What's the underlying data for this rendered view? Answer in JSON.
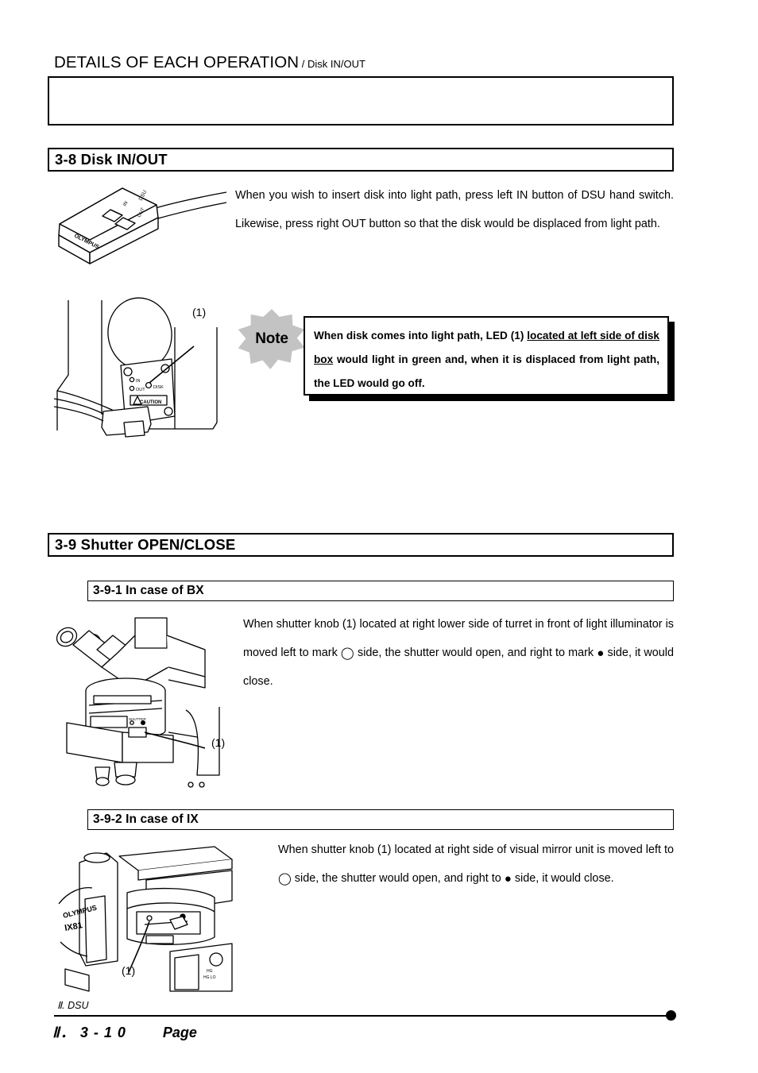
{
  "header": {
    "main_title": "DETAILS OF EACH OPERATION",
    "sub_title": " / Disk IN/OUT"
  },
  "sections": {
    "disk_inout": {
      "heading": "3-8 Disk IN/OUT",
      "paragraph": "When you wish to insert disk into light path, press left IN button of DSU hand switch. Likewise, press right OUT button so that the disk would be displaced from light path."
    },
    "shutter": {
      "heading": "3-9 Shutter OPEN/CLOSE",
      "bx": {
        "heading": "3-9-1 In case of BX",
        "paragraph_part1": "When shutter knob (1) located at right lower side of turret in front of light illuminator is moved left to mark ",
        "open_symbol": "◯",
        "paragraph_part2": " side, the shutter would open, and right to mark ",
        "close_symbol": "●",
        "paragraph_part3": " side, it would close."
      },
      "ix": {
        "heading": "3-9-2 In case of IX",
        "paragraph_part1": "When shutter knob (1) located at right side of visual mirror unit is moved left to ",
        "open_symbol": "◯",
        "paragraph_part2": " side, the shutter would open, and right to ",
        "close_symbol": "●",
        "paragraph_part3": " side, it would close."
      }
    }
  },
  "note": {
    "badge_label": "Note",
    "text_part1": "When disk comes into light path, LED (1) ",
    "text_underlined": "located at left side of disk box",
    "text_part2": " would light in green and, when it is displaced from light path, the LED would go off."
  },
  "figures": {
    "hand_switch": {
      "brand": "OLYMPUS",
      "device_label": "DSU",
      "button_in": "IN",
      "button_out": "OUT"
    },
    "disk_box": {
      "callout": "(1)",
      "led_in": "IN",
      "led_out": "OUT",
      "led_disk": "DISK",
      "caution": "CAUTION"
    },
    "bx_microscope": {
      "callout": "(1)",
      "shutter_label": "SHUTTER"
    },
    "ix_microscope": {
      "callout": "(1)",
      "brand": "OLYMPUS",
      "model": "IX81"
    }
  },
  "footer": {
    "volume_label": "Ⅱ. DSU",
    "page_number": "Ⅱ． 3 - 1 0",
    "page_word": "Page"
  },
  "colors": {
    "note_badge": "#c3c3c3",
    "ink": "#000000",
    "paper": "#ffffff"
  }
}
